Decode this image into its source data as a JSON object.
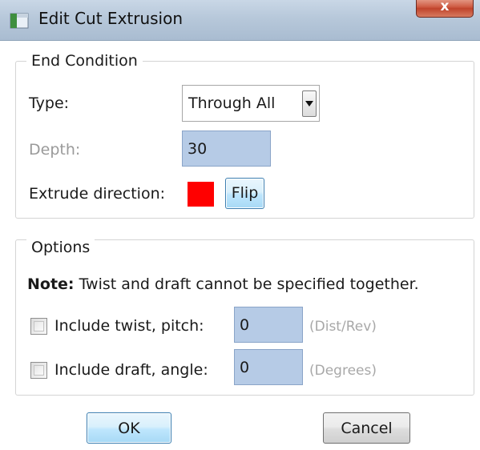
{
  "window": {
    "title": "Edit Cut Extrusion",
    "close_glyph": "x"
  },
  "end_condition": {
    "legend": "End Condition",
    "type_label": "Type:",
    "type_value": "Through All",
    "depth_label": "Depth:",
    "depth_value": "30",
    "extrude_direction_label": "Extrude direction:",
    "direction_color": "#ff0000",
    "flip_label": "Flip"
  },
  "options": {
    "legend": "Options",
    "note_prefix": "Note:",
    "note_text": "Twist and draft cannot be specified together.",
    "twist_label": "Include twist, pitch:",
    "twist_value": "0",
    "twist_unit": "(Dist/Rev)",
    "draft_label": "Include draft, angle:",
    "draft_value": "0",
    "draft_unit": "(Degrees)"
  },
  "buttons": {
    "ok_label": "OK",
    "cancel_label": "Cancel"
  },
  "icons": {
    "title_icon": "app-window-icon",
    "dropdown_icon": "chevron-down-icon"
  }
}
